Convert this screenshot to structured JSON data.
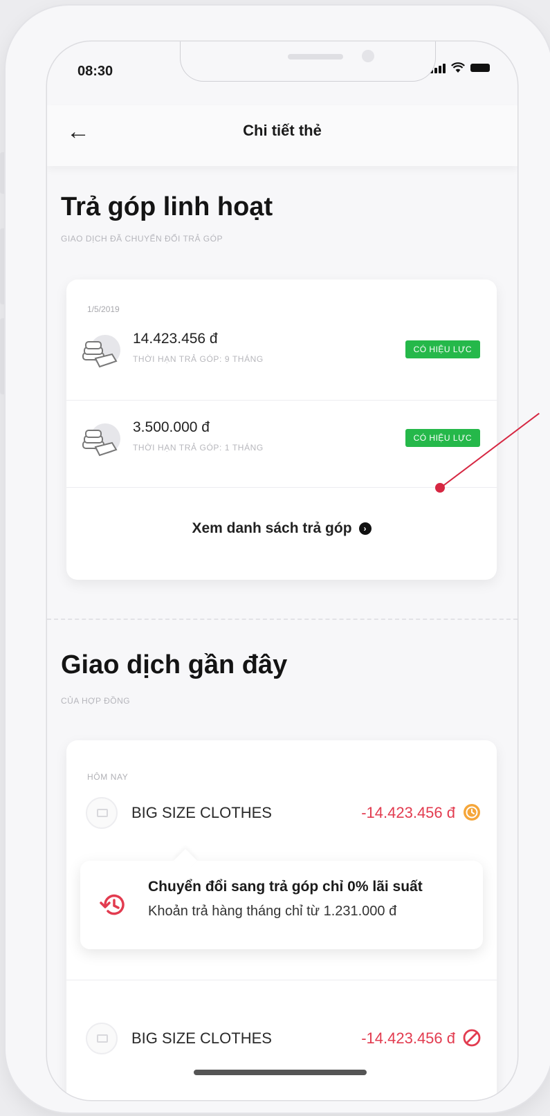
{
  "status_bar": {
    "time": "08:30"
  },
  "header": {
    "title": "Chi tiết thẻ",
    "back_icon": "arrow-left-icon"
  },
  "installments": {
    "title": "Trả góp linh hoạt",
    "subtitle": "GIAO DỊCH ĐÃ CHUYỂN ĐỔI TRẢ GÓP",
    "date": "1/5/2019",
    "items": [
      {
        "amount": "14.423.456 đ",
        "term": "THỜI HẠN TRẢ GÓP: 9 THÁNG",
        "status": "CÓ HIỆU LỰC",
        "icon": "money-stack-icon"
      },
      {
        "amount": "3.500.000 đ",
        "term": "THỜI HẠN TRẢ GÓP: 1 THÁNG",
        "status": "CÓ HIỆU LỰC",
        "icon": "money-stack-icon"
      }
    ],
    "view_list_label": "Xem danh sách trả góp",
    "status_color": "#25b84a"
  },
  "recent": {
    "title": "Giao dịch gần đây",
    "subtitle": "CỦA HỢP ĐỒNG",
    "group_label": "HÔM NAY",
    "transactions": [
      {
        "merchant": "BIG SIZE CLOTHES",
        "amount": "-14.423.456 đ",
        "status_icon": "pending-clock-icon"
      },
      {
        "merchant": "BIG SIZE CLOTHES",
        "amount": "-14.423.456 đ",
        "status_icon": "blocked-icon"
      }
    ],
    "tooltip": {
      "title": "Chuyển đổi sang trả góp chỉ 0% lãi suất",
      "body": "Khoản trả hàng tháng chỉ từ 1.231.000 đ",
      "icon": "history-icon"
    },
    "amount_color": "#e23b4f"
  }
}
